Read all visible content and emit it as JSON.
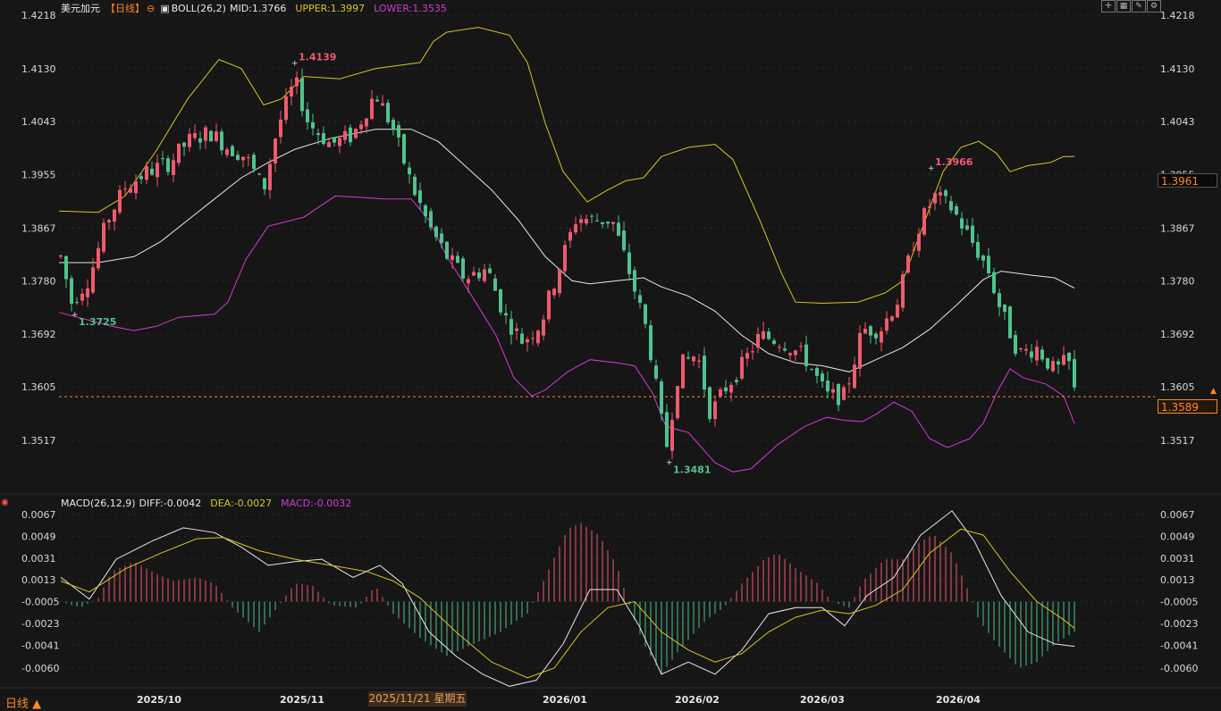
{
  "header": {
    "symbol": "美元加元",
    "period": "【日线】",
    "boll_label": "BOLL(26,2)",
    "mid": "MID:1.3766",
    "upper": "UPPER:1.3997",
    "lower": "LOWER:1.3535"
  },
  "macd_header": {
    "label": "MACD(26,12,9)",
    "diff": "DIFF:-0.0042",
    "dea": "DEA:-0.0027",
    "macd": "MACD:-0.0032"
  },
  "current_price": "1.3589",
  "crosshair_price": "1.3961",
  "date_cursor": "2025/11/21 星期五",
  "period_switch": "日线 ▲",
  "toolbar_icons": [
    "crosshair-icon",
    "layout-icon",
    "draw-icon",
    "settings-icon"
  ],
  "colors": {
    "up": "#ef5a6f",
    "down": "#4fc38e",
    "mid": "#e8e8e8",
    "upper": "#d6c81c",
    "lower": "#d33bd3",
    "diff": "#e8e8e8",
    "dea": "#d6c81c",
    "price_line": "#ff8a1e"
  },
  "chart_data": [
    {
      "type": "candlestick",
      "title": "美元加元【日线】",
      "y_ticks": [
        "1.4218",
        "1.4130",
        "1.4043",
        "1.3955",
        "1.3867",
        "1.3780",
        "1.3692",
        "1.3605",
        "1.3517"
      ],
      "ylim": [
        1.344,
        1.422
      ],
      "x_ticks": [
        "2025/10",
        "2025/11",
        "2026/01",
        "2026/02",
        "2026/03",
        "2026/04"
      ],
      "annotations": [
        {
          "text": "1.4139",
          "kind": "high"
        },
        {
          "text": "1.3725",
          "kind": "low"
        },
        {
          "text": "1.3481",
          "kind": "low"
        },
        {
          "text": "1.3966",
          "kind": "high"
        }
      ],
      "series": [
        {
          "name": "MID",
          "value": 1.3766
        },
        {
          "name": "UPPER",
          "value": 1.3997
        },
        {
          "name": "LOWER",
          "value": 1.3535
        }
      ]
    },
    {
      "type": "histogram",
      "title": "MACD(26,12,9)",
      "y_ticks": [
        "0.0067",
        "0.0049",
        "0.0031",
        "0.0013",
        "-0.0005",
        "-0.0023",
        "-0.0041",
        "-0.0060"
      ],
      "ylim": [
        -0.0075,
        0.0072
      ]
    }
  ]
}
